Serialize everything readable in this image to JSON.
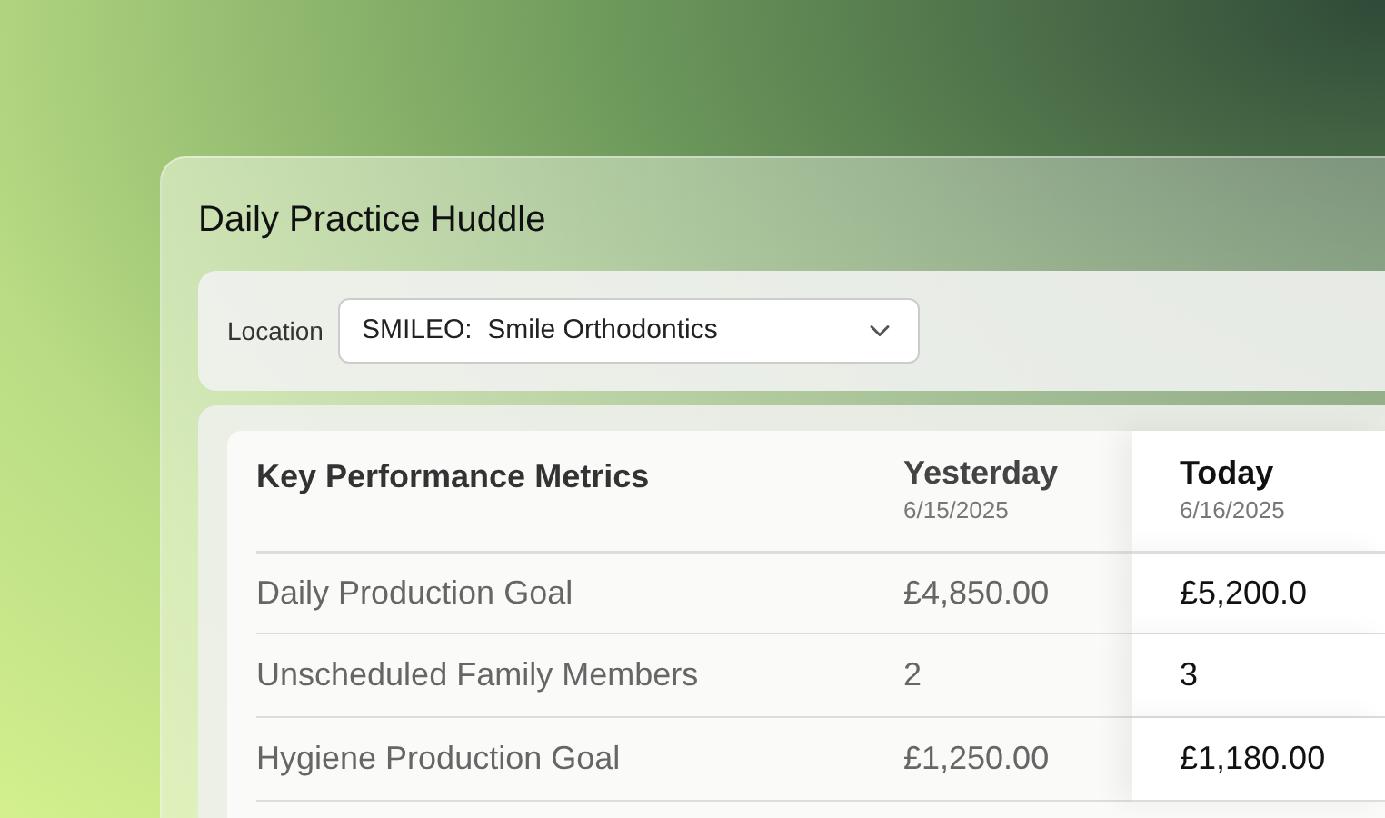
{
  "title": "Daily Practice Huddle",
  "location": {
    "label": "Location",
    "value": "SMILEO:  Smile Orthodontics"
  },
  "table": {
    "heading": "Key Performance Metrics",
    "columns": [
      {
        "label": "Yesterday",
        "date": "6/15/2025",
        "selected": false
      },
      {
        "label": "Today",
        "date": "6/16/2025",
        "selected": true
      }
    ],
    "rows": [
      {
        "metric": "Daily Production Goal",
        "values": [
          "£4,850.00",
          "£5,200.0"
        ]
      },
      {
        "metric": "Unscheduled Family Members",
        "values": [
          "2",
          "3"
        ]
      },
      {
        "metric": "Hygiene Production Goal",
        "values": [
          "£1,250.00",
          "£1,180.00"
        ]
      }
    ]
  }
}
